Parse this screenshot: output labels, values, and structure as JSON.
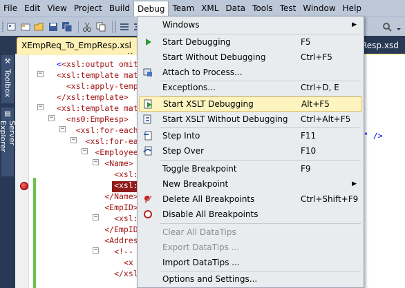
{
  "menubar": {
    "items": [
      "File",
      "Edit",
      "View",
      "Project",
      "Build",
      "Debug",
      "Team",
      "XML",
      "Data",
      "Tools",
      "Test",
      "Window",
      "Help"
    ]
  },
  "dock": {
    "toolbox": "Toolbox",
    "server_explorer": "Server Explorer"
  },
  "tabs": {
    "active": "XEmpReq_To_EmpResp.xsl",
    "active_close": "×",
    "right": "Resp.xsd"
  },
  "editor": {
    "lines": [
      "<xsl:output omit-",
      "<xsl:template mat",
      "  <xsl:apply-temp",
      "</xsl:template>",
      "<xsl:template mat",
      "  <ns0:EmpResp>",
      "    <xsl:for-each",
      "      <xsl:for-ea",
      "        <Employee",
      "          <Name>",
      "            <xsl:",
      "            <xsl:",
      "          </Name>",
      "          <EmpID>",
      "            <xsl:",
      "          </EmpID",
      "          <Addres",
      "            <!--",
      "              <x",
      "            </xsl"
    ],
    "right_fragment": "\" />"
  },
  "debug_menu": {
    "items": [
      {
        "label": "Windows",
        "shortcut": "",
        "submenu": true
      },
      {
        "label": "Start Debugging",
        "shortcut": "F5"
      },
      {
        "label": "Start Without Debugging",
        "shortcut": "Ctrl+F5"
      },
      {
        "label": "Attach to Process...",
        "shortcut": ""
      },
      {
        "label": "Exceptions...",
        "shortcut": "Ctrl+D, E"
      },
      {
        "label": "Start XSLT Debugging",
        "shortcut": "Alt+F5",
        "highlighted": true
      },
      {
        "label": "Start XSLT Without Debugging",
        "shortcut": "Ctrl+Alt+F5"
      },
      {
        "label": "Step Into",
        "shortcut": "F11"
      },
      {
        "label": "Step Over",
        "shortcut": "F10"
      },
      {
        "label": "Toggle Breakpoint",
        "shortcut": "F9"
      },
      {
        "label": "New Breakpoint",
        "shortcut": "",
        "submenu": true
      },
      {
        "label": "Delete All Breakpoints",
        "shortcut": "Ctrl+Shift+F9"
      },
      {
        "label": "Disable All Breakpoints",
        "shortcut": ""
      },
      {
        "label": "Clear All DataTips",
        "shortcut": "",
        "disabled": true
      },
      {
        "label": "Export DataTips ...",
        "shortcut": "",
        "disabled": true
      },
      {
        "label": "Import DataTips ...",
        "shortcut": ""
      },
      {
        "label": "Options and Settings...",
        "shortcut": ""
      }
    ]
  },
  "colors": {
    "chrome": "#bcc7d8",
    "dark_bg": "#293955",
    "highlight": "#fdf4bf",
    "tab_active": "#fdf1b5"
  }
}
